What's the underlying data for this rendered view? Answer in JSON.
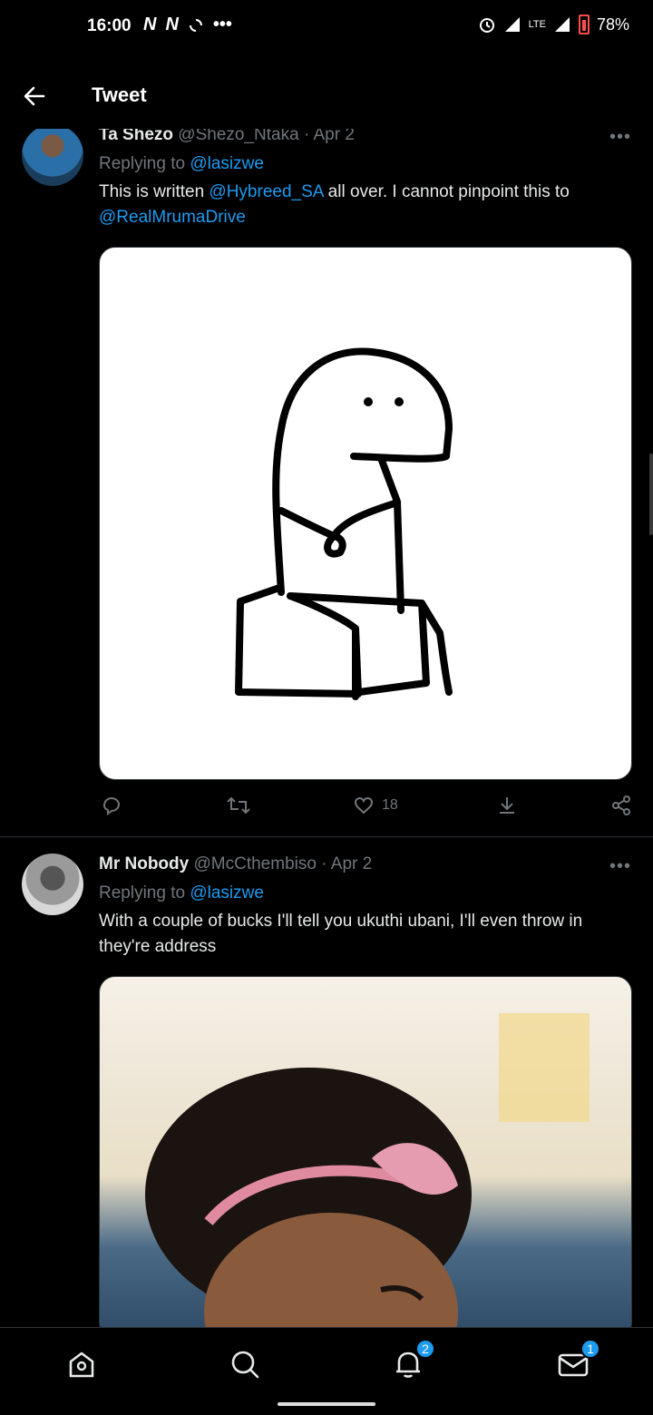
{
  "status_bar": {
    "time": "16:00",
    "notif_icons": [
      "N",
      "N"
    ],
    "network": "LTE",
    "battery": "78%"
  },
  "header": {
    "title": "Tweet"
  },
  "tweets": [
    {
      "name": "Ta Shezo",
      "handle": "@Shezo_Ntaka",
      "date": "· Apr 2",
      "replying_prefix": "Replying to",
      "replying_to": "@lasizwe",
      "text_parts": [
        "This is written ",
        "@Hybreed_SA",
        " all over. I cannot pinpoint this to ",
        "@RealMrumaDrive"
      ],
      "likes": "18"
    },
    {
      "name": "Mr Nobody",
      "handle": "@McCthembiso",
      "date": "· Apr 2",
      "replying_prefix": "Replying to",
      "replying_to": "@lasizwe",
      "text": "With a couple of bucks I'll tell you ukuthi ubani, I'll even throw in they're address"
    }
  ],
  "bottom_nav": {
    "notifications_badge": "2",
    "messages_badge": "1"
  },
  "colors": {
    "accent": "#1d9bf0",
    "muted": "#71767b",
    "background": "#000000"
  }
}
